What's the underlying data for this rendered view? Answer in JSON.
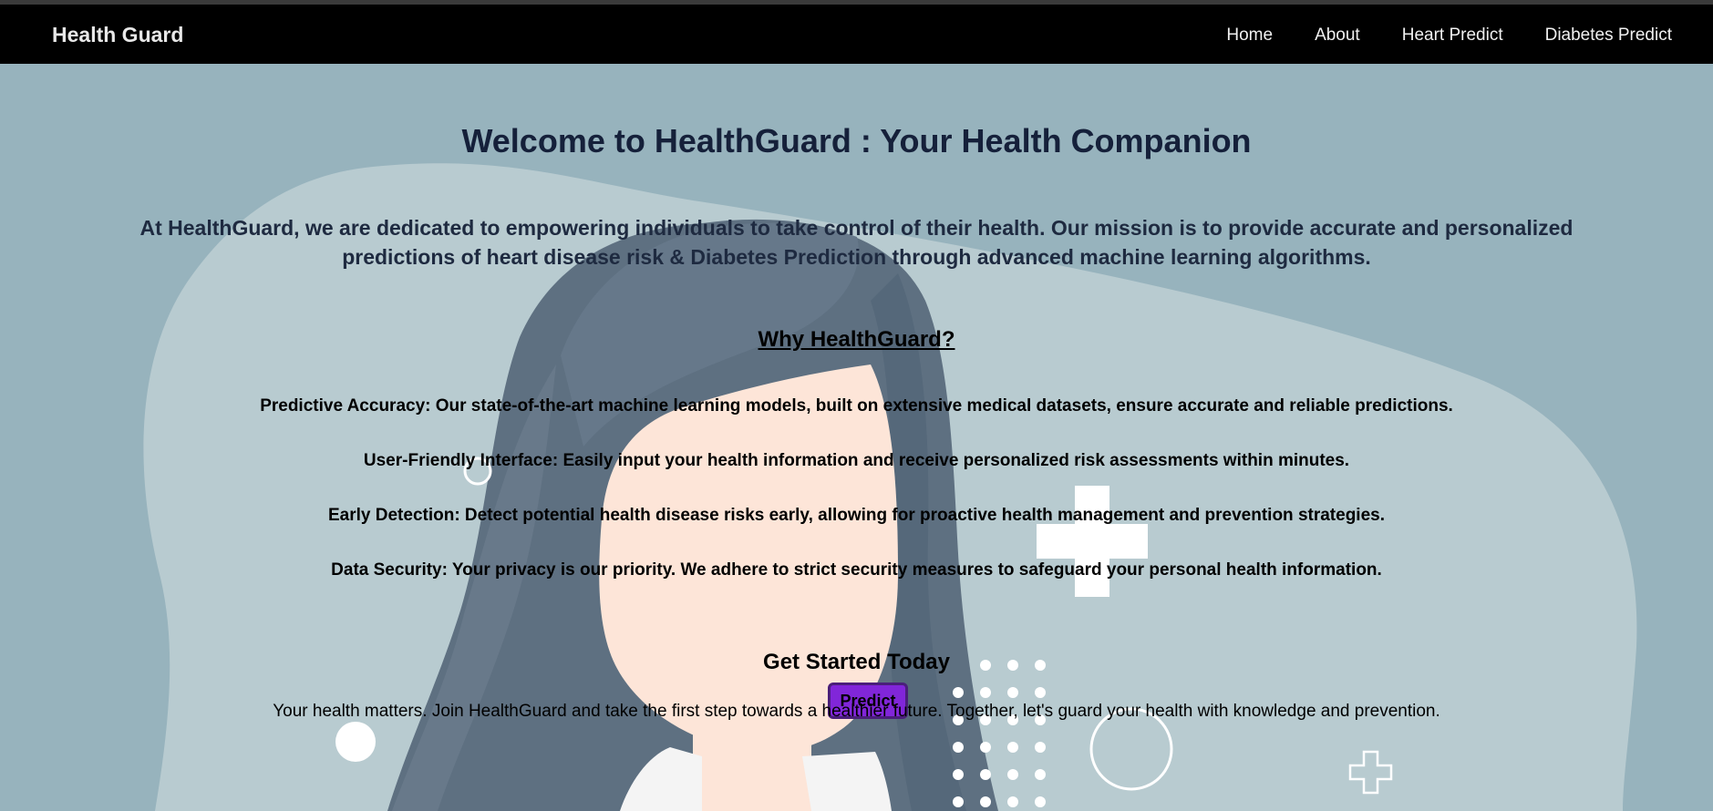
{
  "nav": {
    "brand": "Health Guard",
    "links": [
      "Home",
      "About",
      "Heart Predict",
      "Diabetes Predict"
    ]
  },
  "hero": {
    "title": "Welcome to HealthGuard : Your Health Companion",
    "mission": "At HealthGuard, we are dedicated to empowering individuals to take control of their health. Our mission is to provide accurate and personalized predictions of heart disease risk & Diabetes Prediction through advanced machine learning algorithms."
  },
  "why": {
    "heading": "Why HealthGuard?",
    "features": [
      "Predictive Accuracy: Our state-of-the-art machine learning models, built on extensive medical datasets, ensure accurate and reliable predictions.",
      "User-Friendly Interface: Easily input your health information and receive personalized risk assessments within minutes.",
      "Early Detection: Detect potential health disease risks early, allowing for proactive health management and prevention strategies.",
      "Data Security: Your privacy is our priority. We adhere to strict security measures to safeguard your personal health information."
    ]
  },
  "get_started": {
    "heading": "Get Started Today",
    "text": "Your health matters. Join HealthGuard and take the first step towards a healthier future. Together, let's guard your health with knowledge and prevention.",
    "button": "Predict"
  },
  "colors": {
    "navbar": "#000000",
    "background": "#97b3bd",
    "blob": "#b8cbd0",
    "button": "#8126d9",
    "hair": "#5d6f80",
    "skin": "#fde5d8"
  },
  "icons": [
    "medical-cross-icon",
    "medical-cross-outline-icon"
  ]
}
